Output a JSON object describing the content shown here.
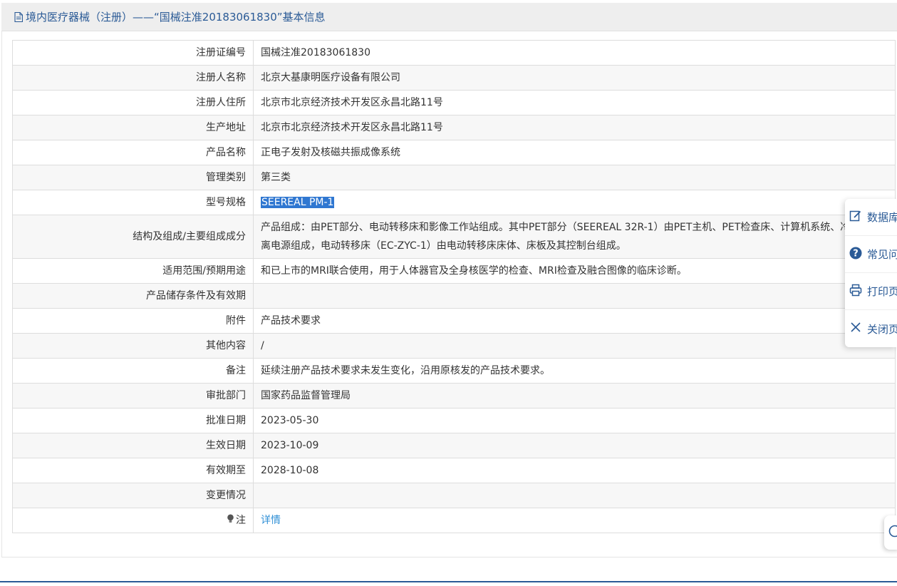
{
  "header": {
    "title": "境内医疗器械（注册）——“国械注准20183061830”基本信息",
    "icon": "document-icon"
  },
  "table": {
    "rows": [
      {
        "label": "注册证编号",
        "value": "国械注准20183061830"
      },
      {
        "label": "注册人名称",
        "value": "北京大基康明医疗设备有限公司"
      },
      {
        "label": "注册人住所",
        "value": "北京市北京经济技术开发区永昌北路11号"
      },
      {
        "label": "生产地址",
        "value": "北京市北京经济技术开发区永昌北路11号"
      },
      {
        "label": "产品名称",
        "value": "正电子发射及核磁共振成像系统"
      },
      {
        "label": "管理类别",
        "value": "第三类"
      },
      {
        "label": "型号规格",
        "value": "SEEREAL PM-1"
      },
      {
        "label": "结构及组成/主要组成成分",
        "value": "产品组成：由PET部分、电动转移床和影像工作站组成。其中PET部分（SEEREAL 32R-1）由PET主机、PET检查床、计算机系统、冷机和隔离电源组成，电动转移床（EC-ZYC-1）由电动转移床床体、床板及其控制台组成。"
      },
      {
        "label": "适用范围/预期用途",
        "value": "和已上市的MRI联合使用，用于人体器官及全身核医学的检查、MRI检查及融合图像的临床诊断。"
      },
      {
        "label": "产品储存条件及有效期",
        "value": ""
      },
      {
        "label": "附件",
        "value": "产品技术要求"
      },
      {
        "label": "其他内容",
        "value": "/"
      },
      {
        "label": "备注",
        "value": "延续注册产品技术要求未发生变化，沿用原核发的产品技术要求。"
      },
      {
        "label": "审批部门",
        "value": "国家药品监督管理局"
      },
      {
        "label": "批准日期",
        "value": "2023-05-30"
      },
      {
        "label": "生效日期",
        "value": "2023-10-09"
      },
      {
        "label": "有效期至",
        "value": "2028-10-08"
      },
      {
        "label": "变更情况",
        "value": ""
      },
      {
        "label": "注",
        "value": "详情"
      }
    ]
  },
  "float_menu": {
    "items": [
      {
        "label": "数据库",
        "icon": "edit-icon"
      },
      {
        "label": "常见问题",
        "icon": "question-icon"
      },
      {
        "label": "打印页面",
        "icon": "printer-icon"
      },
      {
        "label": "关闭页面",
        "icon": "close-icon"
      }
    ]
  },
  "colors": {
    "accent": "#2a5a96",
    "link": "#2f8fd6",
    "selection": "#2f77d1",
    "header_bg": "#eeeeee",
    "row_alt": "#f7f7f7"
  }
}
